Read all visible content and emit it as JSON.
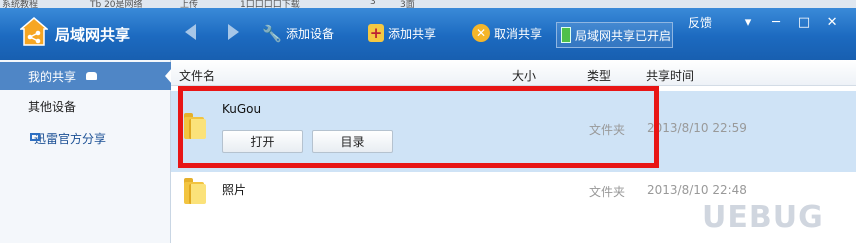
{
  "taskbar": [
    "系统教程",
    "Tb 20是网络",
    "上传",
    "1口口口口下载",
    "3",
    "3面"
  ],
  "app": {
    "title": "局域网共享"
  },
  "toolbar": {
    "add_device": "添加设备",
    "add_share": "添加共享",
    "cancel_share": "取消共享",
    "shared_status": "局域网共享已开启"
  },
  "window": {
    "feedback": "反馈",
    "menu": "▾",
    "minimize": "─",
    "maximize": "□",
    "close": "✕"
  },
  "sidebar": {
    "my_share": "我的共享",
    "other_devices": "其他设备",
    "thunder_share": "迅雷官方分享"
  },
  "columns": {
    "name": "文件名",
    "size": "大小",
    "type": "类型",
    "time": "共享时间"
  },
  "files": [
    {
      "name": "KuGou",
      "type": "文件夹",
      "time": "2013/8/10 22:59",
      "open": "打开",
      "dir": "目录"
    },
    {
      "name": "照片",
      "type": "文件夹",
      "time": "2013/8/10 22:48"
    }
  ],
  "watermark": "UEBUG",
  "colors": {
    "titlebar": "#1c6ac0",
    "selection": "#cfe3f6",
    "highlight_box": "#e81515"
  }
}
